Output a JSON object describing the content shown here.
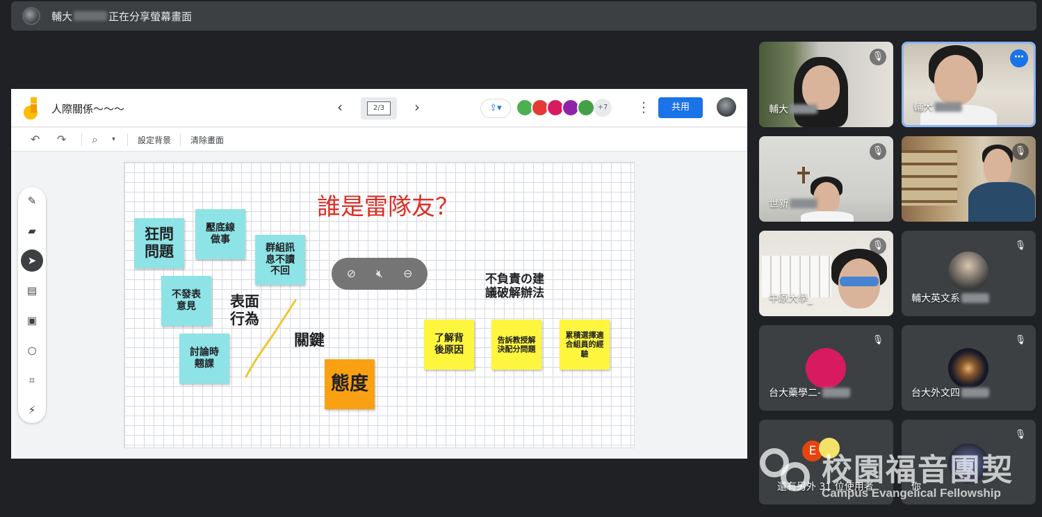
{
  "banner": {
    "prefix": "輔大",
    "suffix": "正在分享螢幕畫面"
  },
  "jamboard": {
    "title": "人際關係～～～",
    "frame_indicator": "2/3",
    "share_label": "共用",
    "more_collaborators": "+7",
    "toolbar": {
      "set_background": "設定背景",
      "clear_frame": "清除畫面"
    },
    "board_title": "誰是雷隊友？",
    "stickies": [
      {
        "text": "狂問\n問題",
        "color": "cyan"
      },
      {
        "text": "壓底線\n做事",
        "color": "cyan"
      },
      {
        "text": "群組訊\n息不讀\n不回",
        "color": "cyan"
      },
      {
        "text": "不發表\n意見",
        "color": "cyan"
      },
      {
        "text": "討論時\n翹課",
        "color": "cyan"
      },
      {
        "text": "態度",
        "color": "orange"
      },
      {
        "text": "了解背\n後原因",
        "color": "yellow"
      },
      {
        "text": "告訴教授解\n決配分問題",
        "color": "yellow"
      },
      {
        "text": "累積選擇適\n合組員的經\n驗",
        "color": "yellow"
      }
    ],
    "handwriting": {
      "surface": "表面\n行為",
      "key": "關鍵",
      "bad_advice": "不負責の建\n議破解辦法"
    }
  },
  "participants": [
    {
      "name": "輔大"
    },
    {
      "name": "輔大"
    },
    {
      "name": "世新"
    },
    {
      "name": ""
    },
    {
      "name": "中原大學_"
    },
    {
      "name": "輔大英文系"
    },
    {
      "name": "台大藥學二-"
    },
    {
      "name": "台大外文四"
    },
    {
      "name": "還有另外 31 位使用者",
      "avatar_letter": "E"
    },
    {
      "name": "你"
    }
  ],
  "watermark": {
    "cn": "校園福音團契",
    "en": "Campus Evangelical Fellowship"
  },
  "colors": {
    "meet_bg": "#202124",
    "accent": "#1a73e8",
    "cyan_note": "#8ee3e6",
    "yellow_note": "#fef53f",
    "orange_note": "#f9a113",
    "title_red": "#d93025"
  }
}
